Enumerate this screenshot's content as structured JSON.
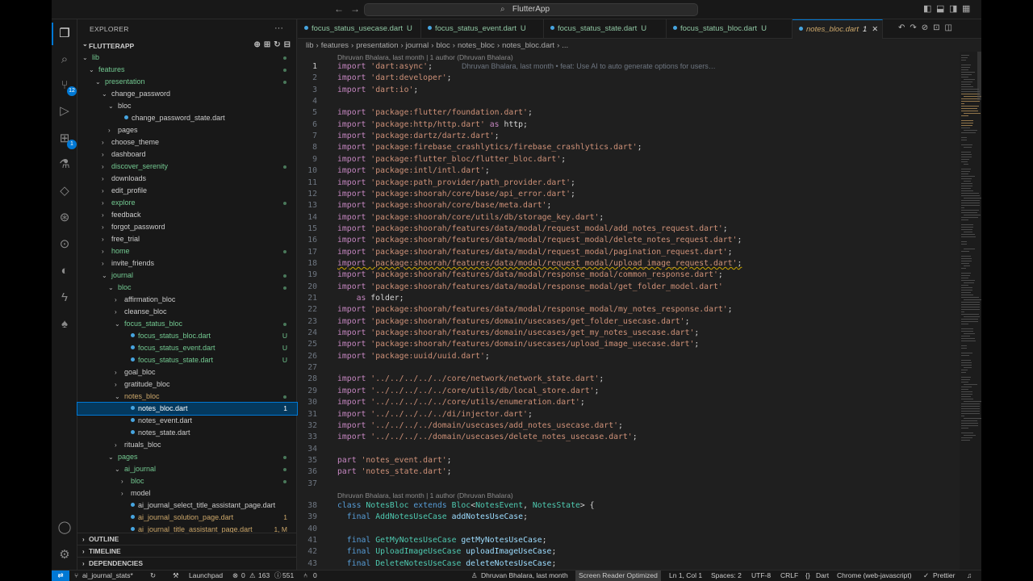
{
  "title": {
    "search_label": "FlutterApp",
    "back": "←",
    "forward": "→"
  },
  "activity": {
    "scm_badge": "12",
    "ext_badge": "1"
  },
  "sidebar": {
    "title": "EXPLORER",
    "project": "FLUTTERAPP",
    "tree": [
      {
        "label": "lib",
        "depth": 1,
        "kind": "open",
        "color": "#73c991",
        "dot": true
      },
      {
        "label": "features",
        "depth": 2,
        "kind": "open",
        "color": "#73c991",
        "dot": true
      },
      {
        "label": "presentation",
        "depth": 3,
        "kind": "open",
        "color": "#73c991",
        "dot": true
      },
      {
        "label": "change_password",
        "depth": 4,
        "kind": "open",
        "color": "#cccccc"
      },
      {
        "label": "bloc",
        "depth": 5,
        "kind": "open",
        "color": "#cccccc"
      },
      {
        "label": "change_password_state.dart",
        "depth": 6,
        "kind": "file",
        "color": "#cccccc"
      },
      {
        "label": "pages",
        "depth": 5,
        "kind": "closed",
        "color": "#cccccc"
      },
      {
        "label": "choose_theme",
        "depth": 4,
        "kind": "closed",
        "color": "#cccccc"
      },
      {
        "label": "dashboard",
        "depth": 4,
        "kind": "closed",
        "color": "#cccccc"
      },
      {
        "label": "discover_serenity",
        "depth": 4,
        "kind": "closed",
        "color": "#73c991",
        "dot": true
      },
      {
        "label": "downloads",
        "depth": 4,
        "kind": "closed",
        "color": "#cccccc"
      },
      {
        "label": "edit_profile",
        "depth": 4,
        "kind": "closed",
        "color": "#cccccc"
      },
      {
        "label": "explore",
        "depth": 4,
        "kind": "closed",
        "color": "#73c991",
        "dot": true
      },
      {
        "label": "feedback",
        "depth": 4,
        "kind": "closed",
        "color": "#cccccc"
      },
      {
        "label": "forgot_password",
        "depth": 4,
        "kind": "closed",
        "color": "#cccccc"
      },
      {
        "label": "free_trial",
        "depth": 4,
        "kind": "closed",
        "color": "#cccccc"
      },
      {
        "label": "home",
        "depth": 4,
        "kind": "closed",
        "color": "#73c991",
        "dot": true
      },
      {
        "label": "invite_friends",
        "depth": 4,
        "kind": "closed",
        "color": "#cccccc"
      },
      {
        "label": "journal",
        "depth": 4,
        "kind": "open",
        "color": "#73c991",
        "dot": true
      },
      {
        "label": "bloc",
        "depth": 5,
        "kind": "open",
        "color": "#73c991",
        "dot": true
      },
      {
        "label": "affirmation_bloc",
        "depth": 6,
        "kind": "closed",
        "color": "#cccccc"
      },
      {
        "label": "cleanse_bloc",
        "depth": 6,
        "kind": "closed",
        "color": "#cccccc"
      },
      {
        "label": "focus_status_bloc",
        "depth": 6,
        "kind": "open",
        "color": "#73c991",
        "dot": true
      },
      {
        "label": "focus_status_bloc.dart",
        "depth": 7,
        "kind": "file",
        "color": "#73c991",
        "status": "U"
      },
      {
        "label": "focus_status_event.dart",
        "depth": 7,
        "kind": "file",
        "color": "#73c991",
        "status": "U"
      },
      {
        "label": "focus_status_state.dart",
        "depth": 7,
        "kind": "file",
        "color": "#73c991",
        "status": "U"
      },
      {
        "label": "goal_bloc",
        "depth": 6,
        "kind": "closed",
        "color": "#cccccc"
      },
      {
        "label": "gratitude_bloc",
        "depth": 6,
        "kind": "closed",
        "color": "#cccccc"
      },
      {
        "label": "notes_bloc",
        "depth": 6,
        "kind": "open",
        "color": "#cca76a",
        "dot": true
      },
      {
        "label": "notes_bloc.dart",
        "depth": 7,
        "kind": "file",
        "color": "#ffffff",
        "status": "1",
        "selected": true
      },
      {
        "label": "notes_event.dart",
        "depth": 7,
        "kind": "file",
        "color": "#cccccc"
      },
      {
        "label": "notes_state.dart",
        "depth": 7,
        "kind": "file",
        "color": "#cccccc"
      },
      {
        "label": "rituals_bloc",
        "depth": 6,
        "kind": "closed",
        "color": "#cccccc"
      },
      {
        "label": "pages",
        "depth": 5,
        "kind": "open",
        "color": "#73c991",
        "dot": true
      },
      {
        "label": "ai_journal",
        "depth": 6,
        "kind": "open",
        "color": "#73c991",
        "dot": true
      },
      {
        "label": "bloc",
        "depth": 7,
        "kind": "closed",
        "color": "#73c991",
        "dot": true
      },
      {
        "label": "model",
        "depth": 7,
        "kind": "closed",
        "color": "#cccccc"
      },
      {
        "label": "ai_journal_select_title_assistant_page.dart",
        "depth": 7,
        "kind": "file",
        "color": "#cccccc"
      },
      {
        "label": "ai_journal_solution_page.dart",
        "depth": 7,
        "kind": "file",
        "color": "#cca76a",
        "status": "1"
      },
      {
        "label": "ai_journal_title_assistant_page.dart",
        "depth": 7,
        "kind": "file",
        "color": "#cca76a",
        "status": "1, M"
      }
    ],
    "sections": [
      "OUTLINE",
      "TIMELINE",
      "DEPENDENCIES"
    ]
  },
  "tabs": [
    {
      "label": "focus_status_usecase.dart",
      "status": "U"
    },
    {
      "label": "focus_status_event.dart",
      "status": "U"
    },
    {
      "label": "focus_status_state.dart",
      "status": "U"
    },
    {
      "label": "focus_status_bloc.dart",
      "status": "U"
    },
    {
      "label": "notes_bloc.dart",
      "status": "1",
      "active": true
    }
  ],
  "breadcrumbs": [
    "lib",
    "features",
    "presentation",
    "journal",
    "bloc",
    "notes_bloc",
    "notes_bloc.dart",
    "..."
  ],
  "blame": {
    "top": "Dhruvan Bhalara, last month | 1 author (Dhruvan Bhalara)",
    "inline": "Dhruvan Bhalara, last month • feat: Use AI to auto generate options for users…",
    "class": "Dhruvan Bhalara, last month | 1 author (Dhruvan Bhalara)"
  },
  "code": [
    {
      "n": "1",
      "t": "import 'dart:async';"
    },
    {
      "n": "2",
      "t": "import 'dart:developer';"
    },
    {
      "n": "3",
      "t": "import 'dart:io';"
    },
    {
      "n": "4",
      "t": ""
    },
    {
      "n": "5",
      "t": "import 'package:flutter/foundation.dart';"
    },
    {
      "n": "6",
      "t": "import 'package:http/http.dart' as http;"
    },
    {
      "n": "7",
      "t": "import 'package:dartz/dartz.dart';"
    },
    {
      "n": "8",
      "t": "import 'package:firebase_crashlytics/firebase_crashlytics.dart';"
    },
    {
      "n": "9",
      "t": "import 'package:flutter_bloc/flutter_bloc.dart';"
    },
    {
      "n": "10",
      "t": "import 'package:intl/intl.dart';"
    },
    {
      "n": "11",
      "t": "import 'package:path_provider/path_provider.dart';"
    },
    {
      "n": "12",
      "t": "import 'package:shoorah/core/base/api_error.dart';"
    },
    {
      "n": "13",
      "t": "import 'package:shoorah/core/base/meta.dart';"
    },
    {
      "n": "14",
      "t": "import 'package:shoorah/core/utils/db/storage_key.dart';"
    },
    {
      "n": "15",
      "t": "import 'package:shoorah/features/data/modal/request_modal/add_notes_request.dart';"
    },
    {
      "n": "16",
      "t": "import 'package:shoorah/features/data/modal/request_modal/delete_notes_request.dart';"
    },
    {
      "n": "17",
      "t": "import 'package:shoorah/features/data/modal/request_modal/pagination_request.dart';"
    },
    {
      "n": "18",
      "t": "import 'package:shoorah/features/data/modal/request_modal/upload_image_request.dart';"
    },
    {
      "n": "19",
      "t": "import 'package:shoorah/features/data/modal/response_modal/common_response.dart';"
    },
    {
      "n": "20",
      "t": "import 'package:shoorah/features/data/modal/response_modal/get_folder_model.dart'"
    },
    {
      "n": "21",
      "t": "    as folder;"
    },
    {
      "n": "22",
      "t": "import 'package:shoorah/features/data/modal/response_modal/my_notes_response.dart';"
    },
    {
      "n": "23",
      "t": "import 'package:shoorah/features/domain/usecases/get_folder_usecase.dart';"
    },
    {
      "n": "24",
      "t": "import 'package:shoorah/features/domain/usecases/get_my_notes_usecase.dart';"
    },
    {
      "n": "25",
      "t": "import 'package:shoorah/features/domain/usecases/upload_image_usecase.dart';"
    },
    {
      "n": "26",
      "t": "import 'package:uuid/uuid.dart';"
    },
    {
      "n": "27",
      "t": ""
    },
    {
      "n": "28",
      "t": "import '../../../../../core/network/network_state.dart';"
    },
    {
      "n": "29",
      "t": "import '../../../../../core/utils/db/local_store.dart';"
    },
    {
      "n": "30",
      "t": "import '../../../../../core/utils/enumeration.dart';"
    },
    {
      "n": "31",
      "t": "import '../../../../../di/injector.dart';"
    },
    {
      "n": "32",
      "t": "import '../../../../domain/usecases/add_notes_usecase.dart';"
    },
    {
      "n": "33",
      "t": "import '../../../../domain/usecases/delete_notes_usecase.dart';"
    },
    {
      "n": "34",
      "t": ""
    },
    {
      "n": "35",
      "t": "part 'notes_event.dart';"
    },
    {
      "n": "36",
      "t": "part 'notes_state.dart';"
    },
    {
      "n": "37",
      "t": ""
    },
    {
      "n": "38",
      "t": "class NotesBloc extends Bloc<NotesEvent, NotesState> {"
    },
    {
      "n": "39",
      "t": "  final AddNotesUseCase addNotesUseCase;"
    },
    {
      "n": "40",
      "t": ""
    },
    {
      "n": "41",
      "t": "  final GetMyNotesUseCase getMyNotesUseCase;"
    },
    {
      "n": "42",
      "t": "  final UploadImageUseCase uploadImageUseCase;"
    },
    {
      "n": "43",
      "t": "  final DeleteNotesUseCase deleteNotesUseCase;"
    }
  ],
  "status": {
    "branch": "ai_journal_stats*",
    "launchpad": "Launchpad",
    "problems": "0",
    "warnings": "163",
    "infos": "551",
    "ports": "0",
    "blame": "Dhruvan Bhalara, last month",
    "sro": "Screen Reader Optimized",
    "position": "Ln 1, Col 1",
    "spaces": "Spaces: 2",
    "encoding": "UTF-8",
    "eol": "CRLF",
    "braces": "{}",
    "lang": "Dart",
    "device": "Chrome (web-javascript)",
    "prettier": "Prettier"
  }
}
